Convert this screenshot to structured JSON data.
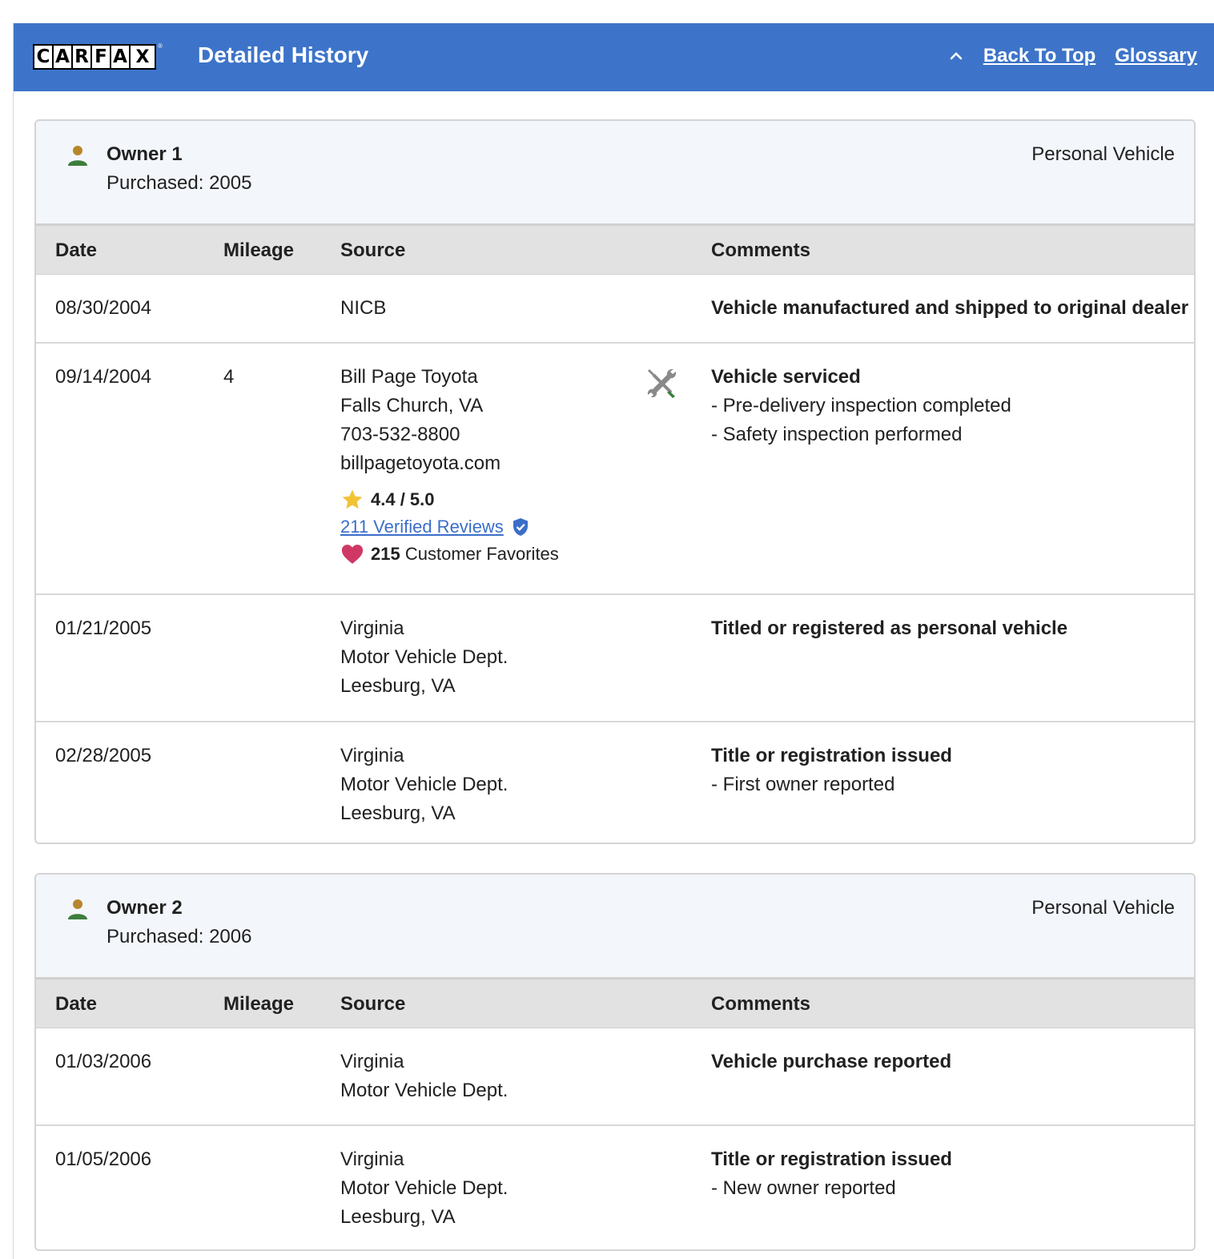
{
  "header": {
    "logo_letters": [
      "C",
      "A",
      "R",
      "F",
      "A",
      "X"
    ],
    "title": "Detailed History",
    "back_to_top": "Back To Top",
    "glossary": "Glossary",
    "color": "#3d74c9"
  },
  "columns": {
    "date": "Date",
    "mileage": "Mileage",
    "source": "Source",
    "comments": "Comments"
  },
  "owners": [
    {
      "name": "Owner 1",
      "purchased": "Purchased: 2005",
      "type": "Personal Vehicle",
      "records": [
        {
          "date": "08/30/2004",
          "mileage": "",
          "source": [
            "NICB"
          ],
          "comment_title": "Vehicle manufactured and shipped to original dealer",
          "details": []
        },
        {
          "date": "09/14/2004",
          "mileage": "4",
          "source": [
            "Bill Page Toyota",
            "Falls Church, VA",
            "703-532-8800",
            "billpagetoyota.com"
          ],
          "rating": "4.4 / 5.0",
          "reviews": "211 Verified Reviews",
          "favorites_count": "215",
          "favorites_label": "Customer Favorites",
          "icon": "service-tools-icon",
          "comment_title": "Vehicle serviced",
          "details": [
            "Pre-delivery inspection completed",
            "Safety inspection performed"
          ]
        },
        {
          "date": "01/21/2005",
          "mileage": "",
          "source": [
            "Virginia",
            "Motor Vehicle Dept.",
            "Leesburg, VA"
          ],
          "comment_title": "Titled or registered as personal vehicle",
          "details": []
        },
        {
          "date": "02/28/2005",
          "mileage": "",
          "source": [
            "Virginia",
            "Motor Vehicle Dept.",
            "Leesburg, VA"
          ],
          "comment_title": "Title or registration issued",
          "details": [
            "First owner reported"
          ]
        }
      ]
    },
    {
      "name": "Owner 2",
      "purchased": "Purchased: 2006",
      "type": "Personal Vehicle",
      "records": [
        {
          "date": "01/03/2006",
          "mileage": "",
          "source": [
            "Virginia",
            "Motor Vehicle Dept."
          ],
          "comment_title": "Vehicle purchase reported",
          "details": []
        },
        {
          "date": "01/05/2006",
          "mileage": "",
          "source": [
            "Virginia",
            "Motor Vehicle Dept.",
            "Leesburg, VA"
          ],
          "comment_title": "Title or registration issued",
          "details": [
            "New owner reported"
          ]
        }
      ]
    }
  ]
}
